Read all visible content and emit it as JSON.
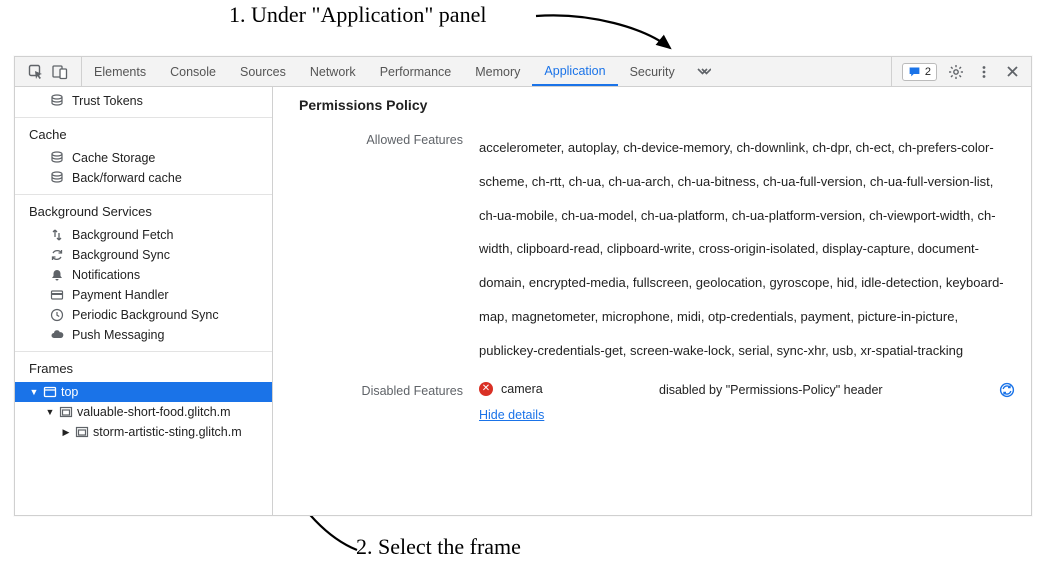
{
  "annotations": {
    "top": "1. Under \"Application\" panel",
    "bottom": "2. Select the frame"
  },
  "toolbar": {
    "tabs": [
      "Elements",
      "Console",
      "Sources",
      "Network",
      "Performance",
      "Memory",
      "Application",
      "Security"
    ],
    "active_tab": "Application",
    "messages_count": "2"
  },
  "sidebar": {
    "storage_last_item": "Trust Tokens",
    "cache": {
      "header": "Cache",
      "items": [
        "Cache Storage",
        "Back/forward cache"
      ]
    },
    "bg": {
      "header": "Background Services",
      "items": [
        "Background Fetch",
        "Background Sync",
        "Notifications",
        "Payment Handler",
        "Periodic Background Sync",
        "Push Messaging"
      ]
    },
    "frames": {
      "header": "Frames",
      "top": "top",
      "children": [
        "valuable-short-food.glitch.m",
        "storm-artistic-sting.glitch.m"
      ]
    }
  },
  "permissions": {
    "title": "Permissions Policy",
    "allowed_label": "Allowed Features",
    "allowed_text": "accelerometer, autoplay, ch-device-memory, ch-downlink, ch-dpr, ch-ect, ch-prefers-color-scheme, ch-rtt, ch-ua, ch-ua-arch, ch-ua-bitness, ch-ua-full-version, ch-ua-full-version-list, ch-ua-mobile, ch-ua-model, ch-ua-platform, ch-ua-platform-version, ch-viewport-width, ch-width, clipboard-read, clipboard-write, cross-origin-isolated, display-capture, document-domain, encrypted-media, fullscreen, geolocation, gyroscope, hid, idle-detection, keyboard-map, magnetometer, microphone, midi, otp-credentials, payment, picture-in-picture, publickey-credentials-get, screen-wake-lock, serial, sync-xhr, usb, xr-spatial-tracking",
    "disabled_label": "Disabled Features",
    "disabled": {
      "name": "camera",
      "reason": "disabled by \"Permissions-Policy\" header"
    },
    "hide_details": "Hide details"
  }
}
